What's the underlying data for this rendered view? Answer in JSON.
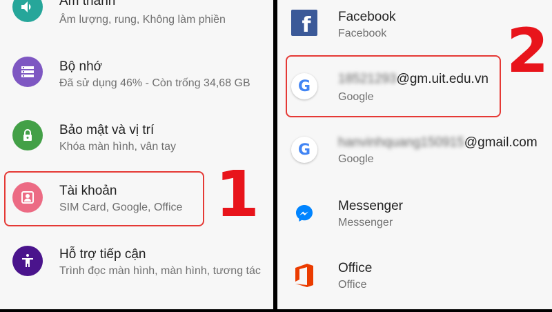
{
  "left": {
    "items": [
      {
        "title": "Âm thanh",
        "subtitle": "Âm lượng, rung, Không làm phiền",
        "icon": "volume-icon",
        "color": "#26a69a"
      },
      {
        "title": "Bộ nhớ",
        "subtitle": "Đã sử dụng 46% - Còn trống 34,68 GB",
        "icon": "storage-icon",
        "color": "#7e57c2"
      },
      {
        "title": "Bảo mật và vị trí",
        "subtitle": "Khóa màn hình, vân tay",
        "icon": "lock-icon",
        "color": "#43a047"
      },
      {
        "title": "Tài khoản",
        "subtitle": "SIM Card, Google, Office",
        "icon": "account-icon",
        "color": "#ec6b84"
      },
      {
        "title": "Hỗ trợ tiếp cận",
        "subtitle": "Trình đọc màn hình, màn hình, tương tác",
        "icon": "accessibility-icon",
        "color": "#4a148c"
      }
    ],
    "step_label": "1"
  },
  "right": {
    "items": [
      {
        "title": "Facebook",
        "subtitle": "Facebook",
        "icon": "facebook-icon"
      },
      {
        "title_blurred": "18521293",
        "title_suffix": "@gm.uit.edu.vn",
        "subtitle": "Google",
        "icon": "google-icon"
      },
      {
        "title_blurred": "hanvinhquang150915",
        "title_suffix": "@gmail.com",
        "subtitle": "Google",
        "icon": "google-icon"
      },
      {
        "title": "Messenger",
        "subtitle": "Messenger",
        "icon": "messenger-icon"
      },
      {
        "title": "Office",
        "subtitle": "Office",
        "icon": "office-icon"
      }
    ],
    "step_label": "2"
  },
  "colors": {
    "highlight": "#e53935",
    "step_number": "#e8141b"
  }
}
